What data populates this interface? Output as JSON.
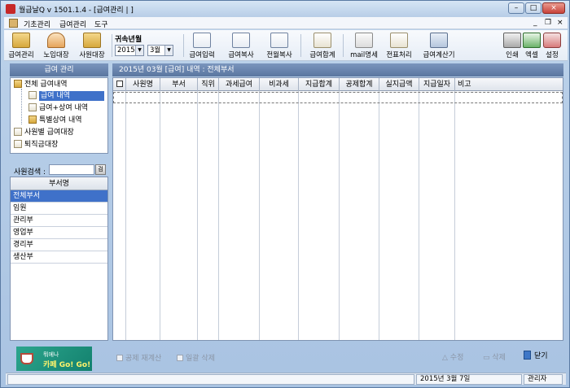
{
  "window": {
    "title": "월급날Q  v 1501.1.4 - [급여관리 | ]",
    "controls": {
      "minimize": "–",
      "maximize": "□",
      "close": "×"
    }
  },
  "menubar": {
    "items": [
      "기초관리",
      "급여관리",
      "도구"
    ],
    "mdi_controls": {
      "minimize": "_",
      "restore": "❐",
      "close": "×"
    }
  },
  "toolbar": {
    "buttons": [
      {
        "label": "급여관리",
        "icon": "salary-folder-icon"
      },
      {
        "label": "노임대장",
        "icon": "wage-ledger-icon"
      },
      {
        "label": "사원대장",
        "icon": "employee-ledger-icon"
      },
      {
        "label": "급여입력",
        "icon": "salary-input-icon"
      },
      {
        "label": "급여복사",
        "icon": "salary-copy-icon"
      },
      {
        "label": "전월복사",
        "icon": "prev-month-copy-icon"
      },
      {
        "label": "급여합계",
        "icon": "salary-total-icon"
      },
      {
        "label": "mail명세",
        "icon": "mail-icon"
      },
      {
        "label": "전표처리",
        "icon": "voucher-icon"
      },
      {
        "label": "급여계산기",
        "icon": "calculator-icon"
      },
      {
        "label": "인쇄",
        "icon": "print-icon"
      },
      {
        "label": "엑셀",
        "icon": "excel-icon"
      },
      {
        "label": "설정",
        "icon": "settings-icon"
      }
    ],
    "period": {
      "label": "귀속년월",
      "year": "2015",
      "month": "3월"
    }
  },
  "left_panel": {
    "title": "급여 관리",
    "tree": [
      {
        "label": "전체 급여내역",
        "icon": "folder-icon"
      },
      {
        "label": "급여 내역",
        "icon": "doc-icon"
      },
      {
        "label": "급여+상여 내역",
        "icon": "doc-icon"
      },
      {
        "label": "특별상여 내역",
        "icon": "folder-icon"
      },
      {
        "label": "사원별 급여대장",
        "icon": "ledger-icon"
      },
      {
        "label": "퇴직금대장",
        "icon": "ledger-icon"
      }
    ],
    "search": {
      "label": "사원검색 :",
      "value": "",
      "button": "검"
    },
    "dept_header": "부서명",
    "depts": [
      "전체부서",
      "임원",
      "관리부",
      "영업부",
      "경리부",
      "생산부"
    ]
  },
  "right_panel": {
    "header": "2015년 03월 [급여] 내역 : 전체부서",
    "columns": [
      "",
      "사원명",
      "부서",
      "직위",
      "과세급여",
      "비과세",
      "지급합계",
      "공제합계",
      "실지급액",
      "지급일자",
      "비고"
    ]
  },
  "bottom": {
    "banner": {
      "top": "뭐에나",
      "main": "카페 Go! Go!"
    },
    "opt1": "공제 재계산",
    "opt2": "일괄 삭제",
    "modify": "수정",
    "delete": "삭제",
    "close": "닫기"
  },
  "statusbar": {
    "date": "2015년 3월 7일",
    "user": "관리자"
  }
}
